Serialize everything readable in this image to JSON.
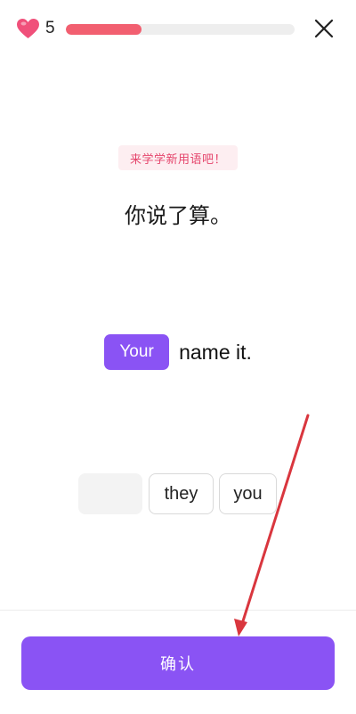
{
  "header": {
    "hearts_count": "5",
    "heart_icon": "heart-icon",
    "progress_fraction": 0.33,
    "close_icon": "close-icon",
    "colors": {
      "heart": "#f0507a",
      "progress": "#f25f70",
      "track": "#eeeeee"
    }
  },
  "prompt": {
    "badge": "来学学新用语吧！",
    "text": "你说了算。"
  },
  "answer": {
    "selected_word": "Your",
    "rest": "name it."
  },
  "word_bank": {
    "words": [
      "they",
      "you"
    ]
  },
  "footer": {
    "confirm_label": "确认"
  },
  "colors": {
    "accent": "#8a53f4",
    "annotation": "#d9363e"
  }
}
